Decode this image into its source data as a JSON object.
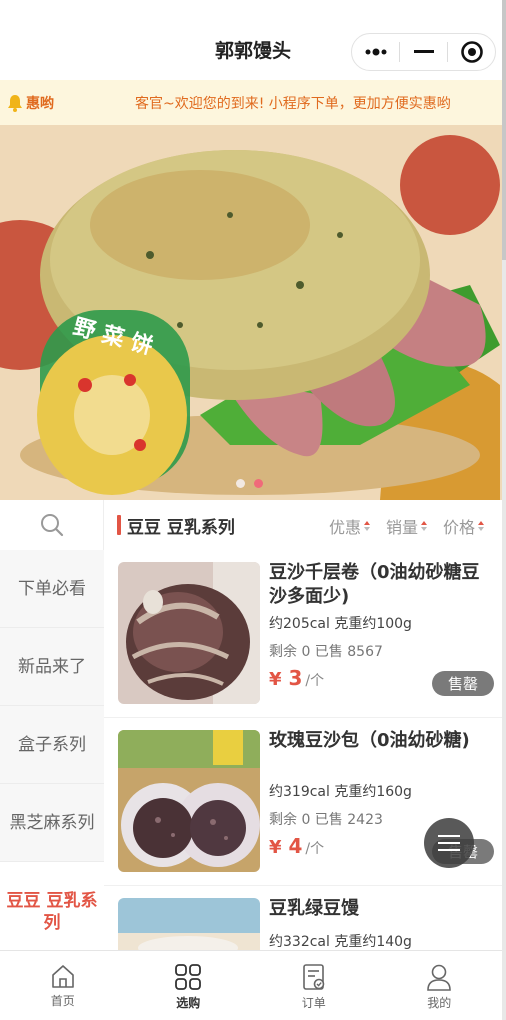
{
  "header": {
    "title": "郭郭馒头",
    "capsule": {
      "more_icon": "more-dots-icon",
      "minimize_icon": "minimize-icon",
      "close_icon": "target-close-icon"
    }
  },
  "notice": {
    "icon": "bell-icon",
    "label": "惠哟",
    "text": "客官~欢迎您的到来! 小程序下单，更加方便实惠哟"
  },
  "banner": {
    "image": "photo of a vegetable pancake sandwich with ham and lettuce, sticker reading 野菜饼",
    "slide_count": 2,
    "active_slide": 2
  },
  "sidebar": {
    "search_icon": "search-icon",
    "items": [
      {
        "label": "下单必看"
      },
      {
        "label": "新品来了"
      },
      {
        "label": "盒子系列"
      },
      {
        "label": "黑芝麻系列"
      },
      {
        "label": "豆豆 豆乳系列"
      }
    ],
    "active_index": 4
  },
  "category": {
    "title": "豆豆 豆乳系列",
    "sorts": [
      {
        "label": "优惠"
      },
      {
        "label": "销量"
      },
      {
        "label": "价格"
      }
    ]
  },
  "products": [
    {
      "name": "豆沙千层卷（0油幼砂糖豆沙多面少)",
      "desc": "约205cal 克重约100g",
      "stock": "剩余 0   已售 8567",
      "currency": "¥",
      "price": "3",
      "unit": "/个",
      "status": "售罄"
    },
    {
      "name": "玫瑰豆沙包（0油幼砂糖)",
      "desc": "约319cal 克重约160g",
      "stock": "剩余 0   已售 2423",
      "currency": "¥",
      "price": "4",
      "unit": "/个",
      "status": "售罄"
    },
    {
      "name": "豆乳绿豆馒",
      "desc": "约332cal 克重约140g",
      "stock": "",
      "currency": "",
      "price": "",
      "unit": "",
      "status": ""
    }
  ],
  "tabbar": {
    "items": [
      {
        "label": "首页",
        "icon": "home-icon"
      },
      {
        "label": "选购",
        "icon": "grid-icon"
      },
      {
        "label": "订单",
        "icon": "order-icon"
      },
      {
        "label": "我的",
        "icon": "user-icon"
      }
    ],
    "active_index": 1
  },
  "colors": {
    "accent": "#e25545",
    "notice_bg": "#fdf6dd",
    "notice_text": "#e06a1e",
    "soldout_bg": "#7a7a7a"
  }
}
